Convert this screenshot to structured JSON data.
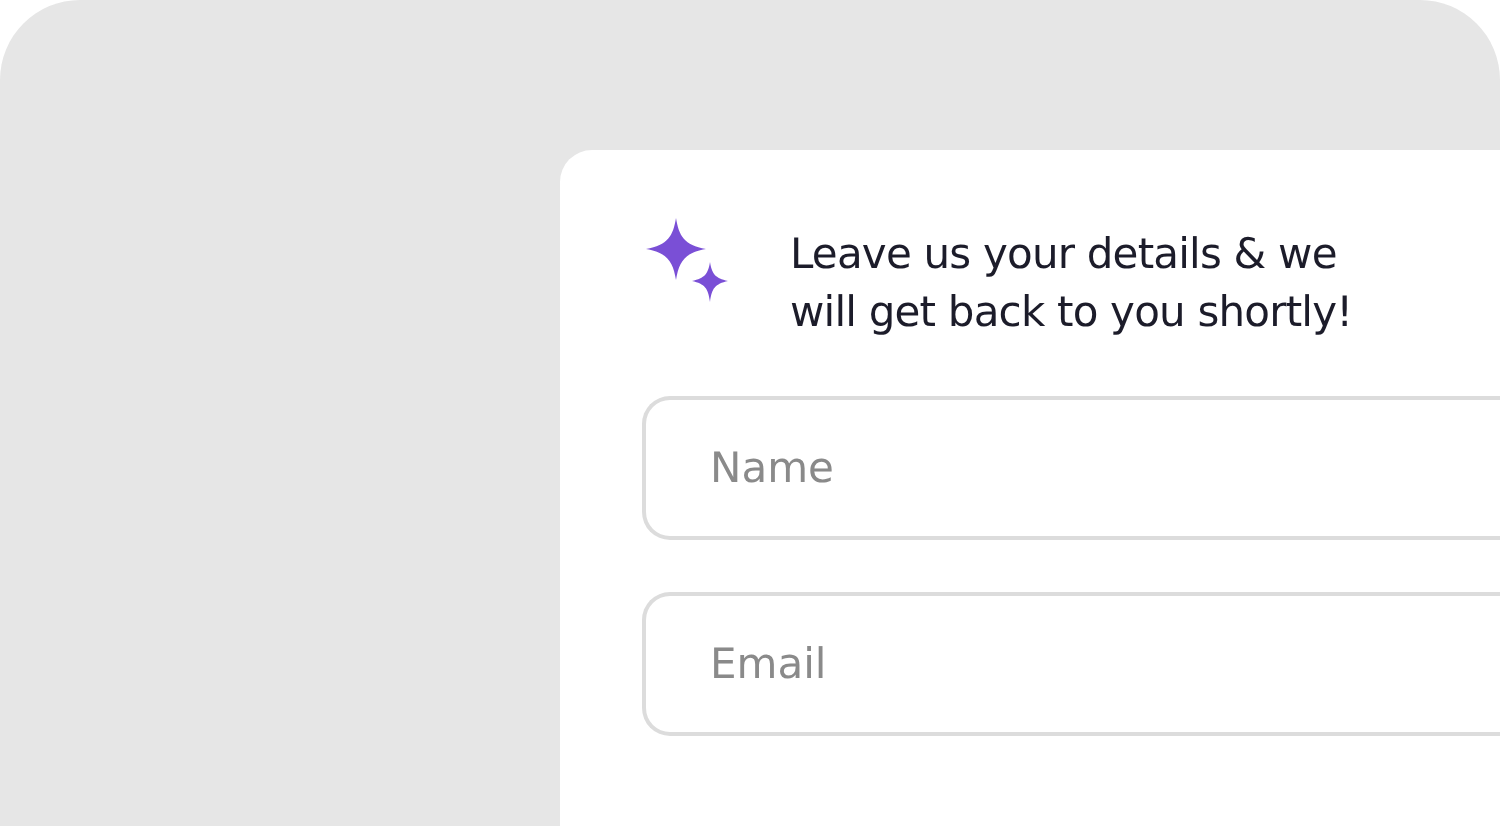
{
  "card": {
    "message": "Leave us your details & we will get back to you shortly!",
    "fields": [
      {
        "placeholder": "Name"
      },
      {
        "placeholder": "Email"
      }
    ]
  }
}
